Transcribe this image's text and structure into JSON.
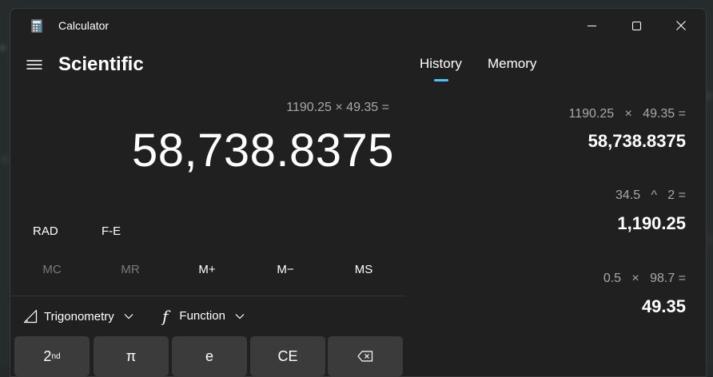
{
  "window": {
    "title": "Calculator",
    "minimize": "minimize",
    "maximize": "maximize",
    "close": "close"
  },
  "header": {
    "mode_title": "Scientific"
  },
  "display": {
    "expression": "1190.25 × 49.35 =",
    "result": "58,738.8375"
  },
  "options": {
    "angle_mode": "RAD",
    "fe": "F-E"
  },
  "memory": {
    "mc": "MC",
    "mr": "MR",
    "mplus": "M+",
    "mminus": "M−",
    "ms": "MS"
  },
  "dropdowns": {
    "trig": "Trigonometry",
    "function": "Function"
  },
  "keys": {
    "second": "2",
    "second_sup": "nd",
    "pi": "π",
    "e": "e",
    "ce": "CE"
  },
  "tabs": {
    "history": "History",
    "memory": "Memory",
    "active": "History"
  },
  "history": [
    {
      "expression": "1190.25   ×   49.35 =",
      "result": "58,738.8375"
    },
    {
      "expression": "34.5   ^   2 =",
      "result": "1,190.25"
    },
    {
      "expression": "0.5   ×   98.7 =",
      "result": "49.35"
    }
  ],
  "colors": {
    "accent": "#4cc2ff",
    "background": "#202020",
    "button": "#3b3b3b"
  },
  "icons": {
    "app": "calculator-icon",
    "menu": "hamburger-icon",
    "trig": "triangle-ruler-icon",
    "function": "function-f-icon",
    "chevron": "chevron-down-icon",
    "backspace": "backspace-icon"
  }
}
